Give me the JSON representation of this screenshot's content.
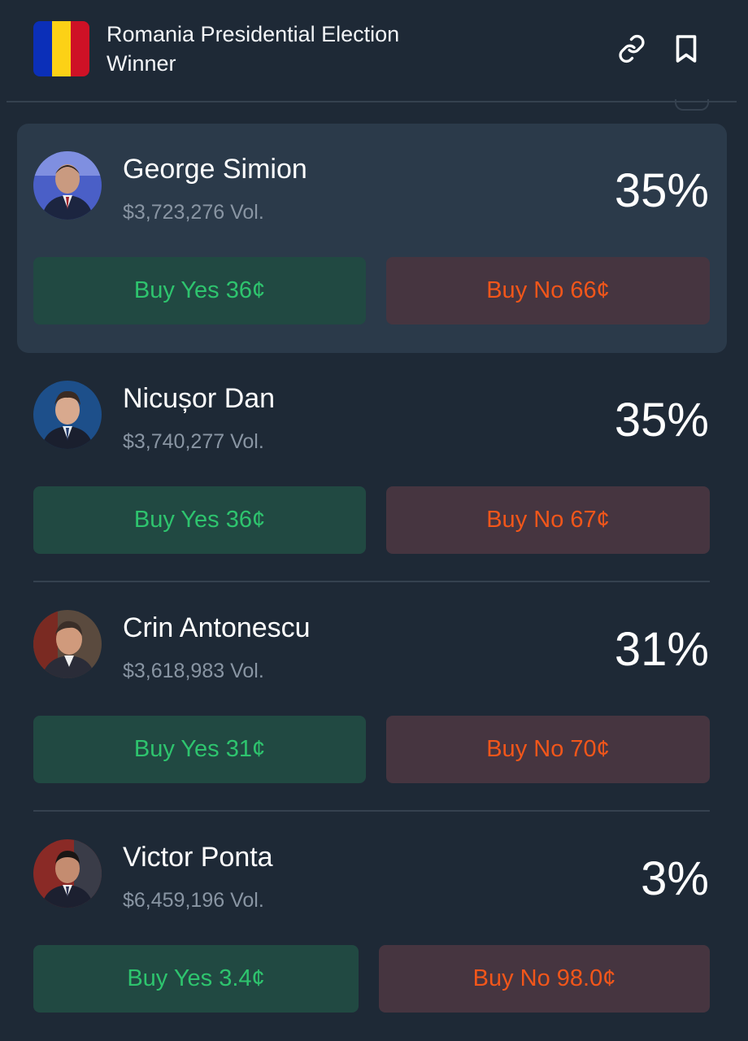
{
  "header": {
    "title": "Romania Presidential Election Winner",
    "flag_colors": [
      "#0b2fb8",
      "#fcd116",
      "#ce1126"
    ],
    "link_icon": "link-icon",
    "bookmark_icon": "bookmark-icon"
  },
  "colors": {
    "background": "#1e2936",
    "highlight_card": "#2b3a4a",
    "yes_bg": "#214942",
    "yes_text": "#2ec46e",
    "no_bg": "#463540",
    "no_text": "#f2561a",
    "muted_text": "#8995a3"
  },
  "candidates": [
    {
      "name": "George Simion",
      "volume": "$3,723,276 Vol.",
      "percent": "35%",
      "buy_yes": "Buy Yes 36¢",
      "buy_no": "Buy No 66¢"
    },
    {
      "name": "Nicușor Dan",
      "volume": "$3,740,277 Vol.",
      "percent": "35%",
      "buy_yes": "Buy Yes 36¢",
      "buy_no": "Buy No 67¢"
    },
    {
      "name": "Crin Antonescu",
      "volume": "$3,618,983 Vol.",
      "percent": "31%",
      "buy_yes": "Buy Yes 31¢",
      "buy_no": "Buy No 70¢"
    },
    {
      "name": "Victor Ponta",
      "volume": "$6,459,196 Vol.",
      "percent": "3%",
      "buy_yes": "Buy Yes 3.4¢",
      "buy_no": "Buy No 98.0¢"
    }
  ]
}
